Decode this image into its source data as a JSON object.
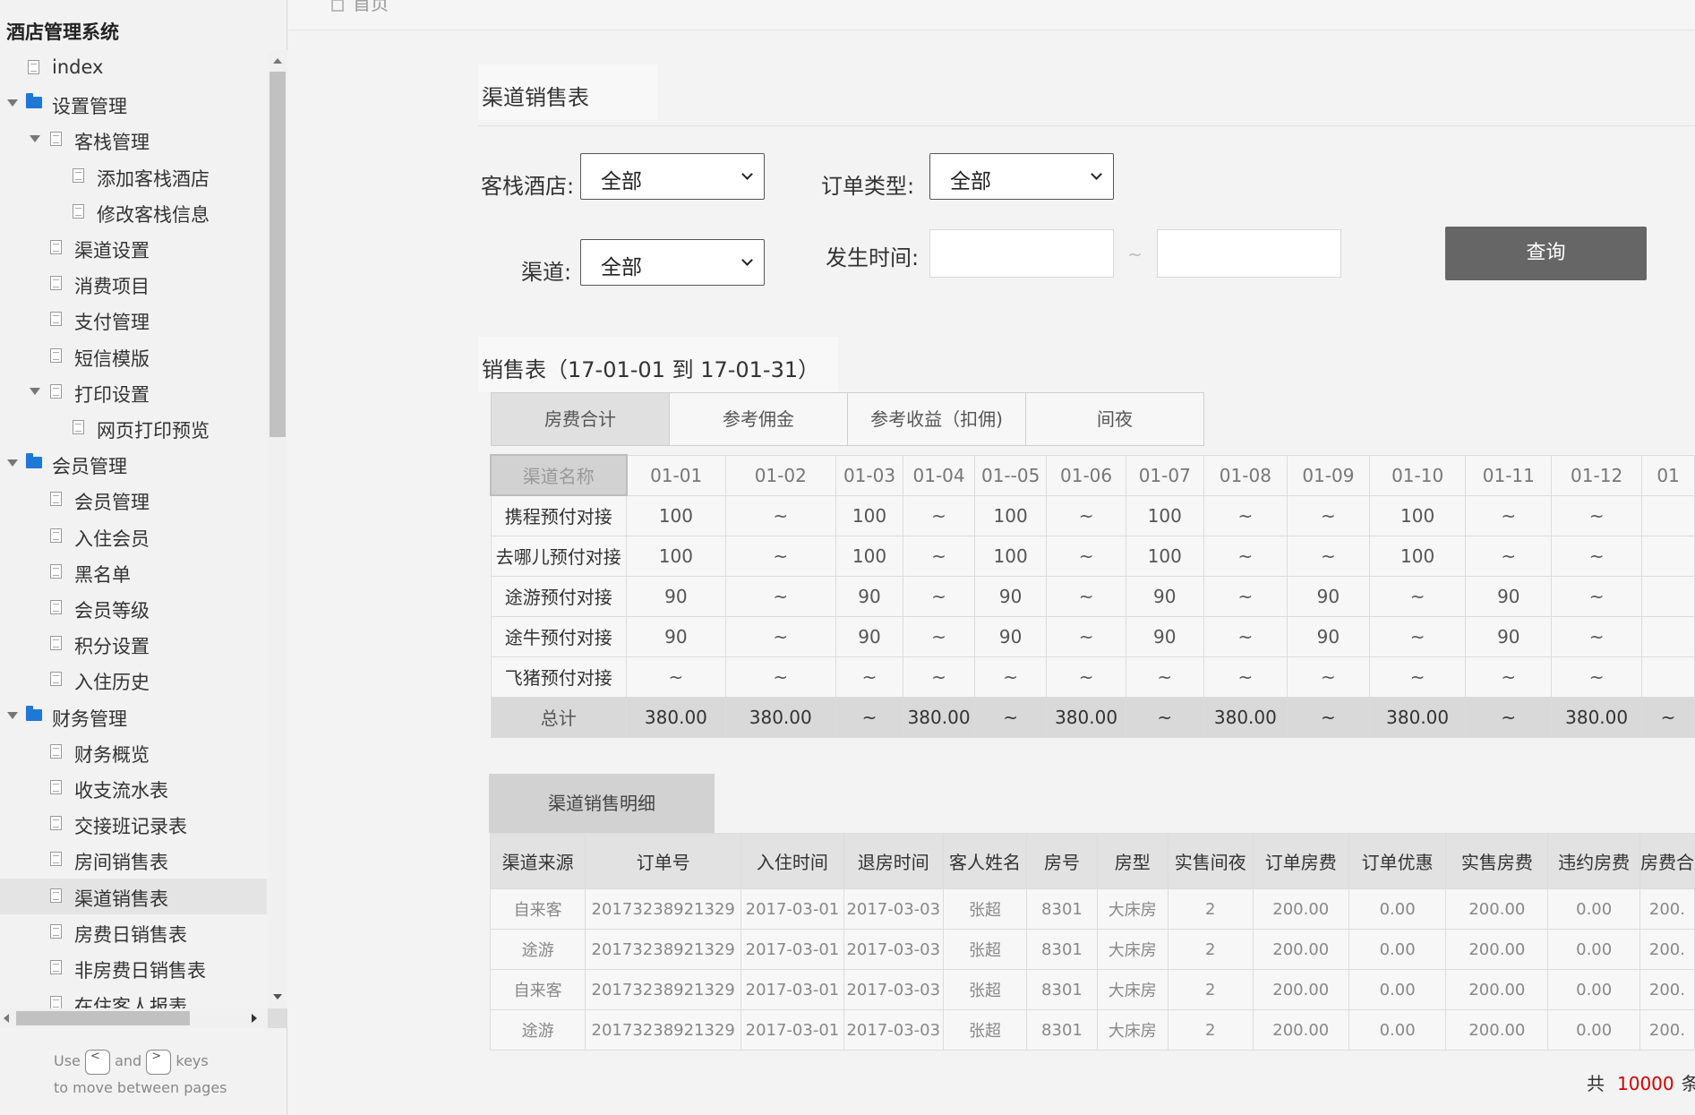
{
  "sidebar": {
    "title": "酒店管理系统",
    "tree": [
      {
        "label": "index",
        "level": 0,
        "icon": "page-icon",
        "arrow": false
      },
      {
        "label": "设置管理",
        "level": 0,
        "icon": "folder-icon",
        "arrow": true
      },
      {
        "label": "客栈管理",
        "level": 1,
        "icon": "page-icon",
        "arrow": true
      },
      {
        "label": "添加客栈酒店",
        "level": 2,
        "icon": "page-icon",
        "arrow": false
      },
      {
        "label": "修改客栈信息",
        "level": 2,
        "icon": "page-icon",
        "arrow": false
      },
      {
        "label": "渠道设置",
        "level": 1,
        "icon": "page-icon",
        "arrow": false
      },
      {
        "label": "消费项目",
        "level": 1,
        "icon": "page-icon",
        "arrow": false
      },
      {
        "label": "支付管理",
        "level": 1,
        "icon": "page-icon",
        "arrow": false
      },
      {
        "label": "短信模版",
        "level": 1,
        "icon": "page-icon",
        "arrow": false
      },
      {
        "label": "打印设置",
        "level": 1,
        "icon": "page-icon",
        "arrow": true
      },
      {
        "label": "网页打印预览",
        "level": 2,
        "icon": "page-icon",
        "arrow": false
      },
      {
        "label": "会员管理",
        "level": 0,
        "icon": "folder-icon",
        "arrow": true
      },
      {
        "label": "会员管理",
        "level": 1,
        "icon": "page-icon",
        "arrow": false
      },
      {
        "label": "入住会员",
        "level": 1,
        "icon": "page-icon",
        "arrow": false
      },
      {
        "label": "黑名单",
        "level": 1,
        "icon": "page-icon",
        "arrow": false
      },
      {
        "label": "会员等级",
        "level": 1,
        "icon": "page-icon",
        "arrow": false
      },
      {
        "label": "积分设置",
        "level": 1,
        "icon": "page-icon",
        "arrow": false
      },
      {
        "label": "入住历史",
        "level": 1,
        "icon": "page-icon",
        "arrow": false
      },
      {
        "label": "财务管理",
        "level": 0,
        "icon": "folder-icon",
        "arrow": true
      },
      {
        "label": "财务概览",
        "level": 1,
        "icon": "page-icon",
        "arrow": false
      },
      {
        "label": "收支流水表",
        "level": 1,
        "icon": "page-icon",
        "arrow": false
      },
      {
        "label": "交接班记录表",
        "level": 1,
        "icon": "page-icon",
        "arrow": false
      },
      {
        "label": "房间销售表",
        "level": 1,
        "icon": "page-icon",
        "arrow": false
      },
      {
        "label": "渠道销售表",
        "level": 1,
        "icon": "page-icon",
        "arrow": false,
        "active": true
      },
      {
        "label": "房费日销售表",
        "level": 1,
        "icon": "page-icon",
        "arrow": false
      },
      {
        "label": "非房费日销售表",
        "level": 1,
        "icon": "page-icon",
        "arrow": false
      },
      {
        "label": "在住客人报表",
        "level": 1,
        "icon": "page-icon",
        "arrow": false
      }
    ],
    "hint": {
      "use": "Use",
      "and": "and",
      "keys": "keys",
      "line2": "to move between pages",
      "key_prev": "<",
      "key_next": ">"
    }
  },
  "breadcrumb": {
    "home": "首页"
  },
  "page_title": "渠道销售表",
  "filters": {
    "hotel_label": "客栈酒店:",
    "hotel_value": "全部",
    "order_type_label": "订单类型:",
    "order_type_value": "全部",
    "channel_label": "渠道:",
    "channel_value": "全部",
    "time_label": "发生时间:",
    "time_separator": "~",
    "time_start": "",
    "time_end": "",
    "query_button": "查询"
  },
  "sales": {
    "title": "销售表（17-01-01 到 17-01-31）",
    "tabs": [
      "房费合计",
      "参考佣金",
      "参考收益（扣佣)",
      "间夜"
    ],
    "active_tab": 0,
    "header_corner": "渠道名称",
    "dates": [
      "01-01",
      "01-02",
      "01-03",
      "01-04",
      "01--05",
      "01-06",
      "01-07",
      "01-08",
      "01-09",
      "01-10",
      "01-11",
      "01-12",
      "01"
    ],
    "rows": [
      {
        "name": "携程预付对接",
        "values": [
          "100",
          "~",
          "100",
          "~",
          "100",
          "~",
          "100",
          "~",
          "~",
          "100",
          "~",
          "~",
          ""
        ]
      },
      {
        "name": "去哪儿预付对接",
        "values": [
          "100",
          "~",
          "100",
          "~",
          "100",
          "~",
          "100",
          "~",
          "~",
          "100",
          "~",
          "~",
          ""
        ]
      },
      {
        "name": "途游预付对接",
        "values": [
          "90",
          "~",
          "90",
          "~",
          "90",
          "~",
          "90",
          "~",
          "90",
          "~",
          "90",
          "~",
          ""
        ]
      },
      {
        "name": "途牛预付对接",
        "values": [
          "90",
          "~",
          "90",
          "~",
          "90",
          "~",
          "90",
          "~",
          "90",
          "~",
          "90",
          "~",
          ""
        ]
      },
      {
        "name": "飞猪预付对接",
        "values": [
          "~",
          "~",
          "~",
          "~",
          "~",
          "~",
          "~",
          "~",
          "~",
          "~",
          "~",
          "~",
          ""
        ]
      },
      {
        "name": "总计",
        "values": [
          "380.00",
          "380.00",
          "~",
          "380.00",
          "~",
          "380.00",
          "~",
          "380.00",
          "~",
          "380.00",
          "~",
          "380.00",
          "~"
        ],
        "total": true
      }
    ]
  },
  "detail": {
    "tab": "渠道销售明细",
    "columns": [
      "渠道来源",
      "订单号",
      "入住时间",
      "退房时间",
      "客人姓名",
      "房号",
      "房型",
      "实售间夜",
      "订单房费",
      "订单优惠",
      "实售房费",
      "违约房费",
      "房费合"
    ],
    "rows": [
      [
        "自来客",
        "20173238921329",
        "2017-03-01",
        "2017-03-03",
        "张超",
        "8301",
        "大床房",
        "2",
        "200.00",
        "0.00",
        "200.00",
        "0.00",
        "200."
      ],
      [
        "途游",
        "20173238921329",
        "2017-03-01",
        "2017-03-03",
        "张超",
        "8301",
        "大床房",
        "2",
        "200.00",
        "0.00",
        "200.00",
        "0.00",
        "200."
      ],
      [
        "自来客",
        "20173238921329",
        "2017-03-01",
        "2017-03-03",
        "张超",
        "8301",
        "大床房",
        "2",
        "200.00",
        "0.00",
        "200.00",
        "0.00",
        "200."
      ],
      [
        "途游",
        "20173238921329",
        "2017-03-01",
        "2017-03-03",
        "张超",
        "8301",
        "大床房",
        "2",
        "200.00",
        "0.00",
        "200.00",
        "0.00",
        "200."
      ]
    ]
  },
  "pager": {
    "prefix": "共",
    "count": "10000",
    "suffix": "条"
  }
}
